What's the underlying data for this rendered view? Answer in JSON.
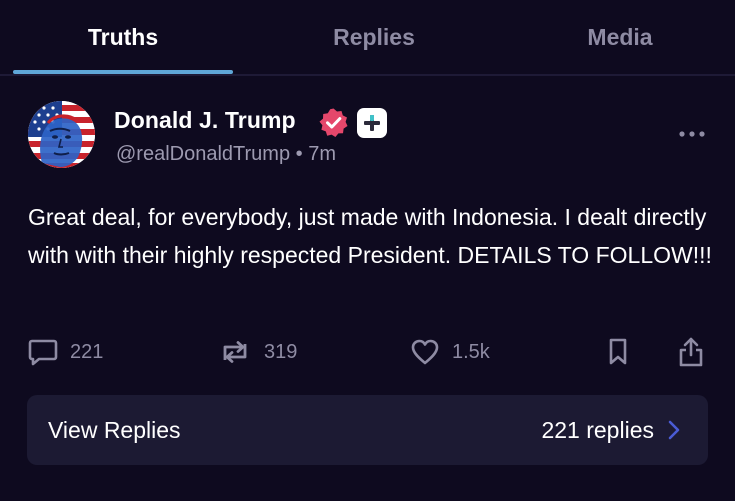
{
  "tabs": {
    "items": [
      {
        "label": "Truths",
        "active": true
      },
      {
        "label": "Replies",
        "active": false
      },
      {
        "label": "Media",
        "active": false
      }
    ]
  },
  "post": {
    "author_name": "Donald J. Trump",
    "handle": "@realDonaldTrump",
    "separator": "•",
    "time_ago": "7m",
    "text": "Great deal, for everybody, just made with Indonesia. I dealt directly with with their highly respected President. DETAILS TO FOLLOW!!!",
    "icons": {
      "verified": "verified-badge-icon",
      "plus": "plus-badge-icon",
      "more": "more-options-icon"
    }
  },
  "actions": {
    "replies_count": "221",
    "retruths_count": "319",
    "likes_count": "1.5k"
  },
  "view_replies": {
    "label": "View Replies",
    "count_text": "221 replies"
  },
  "colors": {
    "background": "#0e0a1f",
    "tab_underline": "#5fa7d8",
    "verified_badge": "#e5476b",
    "muted_text": "#8e8ba3",
    "card_background": "#1c1a33",
    "chevron": "#4a5bd4"
  }
}
